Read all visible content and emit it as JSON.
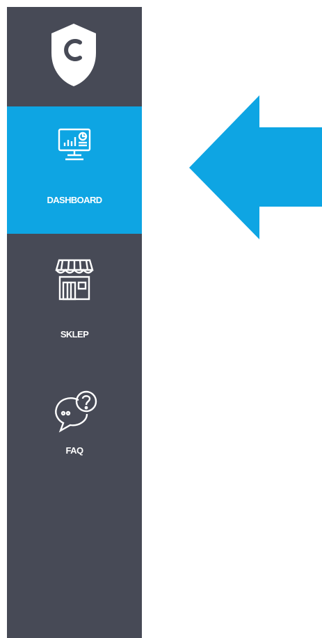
{
  "colors": {
    "sidebar_bg": "#474a56",
    "accent": "#0ea5e3",
    "text": "#ffffff"
  },
  "sidebar": {
    "logo_icon": "shield-c-logo",
    "items": [
      {
        "label": "DASHBOARD",
        "icon": "monitor-chart-icon",
        "active": true
      },
      {
        "label": "SKLEP",
        "icon": "store-icon",
        "active": false
      },
      {
        "label": "FAQ",
        "icon": "chat-question-icon",
        "active": false
      }
    ]
  },
  "pointer": {
    "icon": "arrow-left-icon",
    "direction": "left"
  }
}
